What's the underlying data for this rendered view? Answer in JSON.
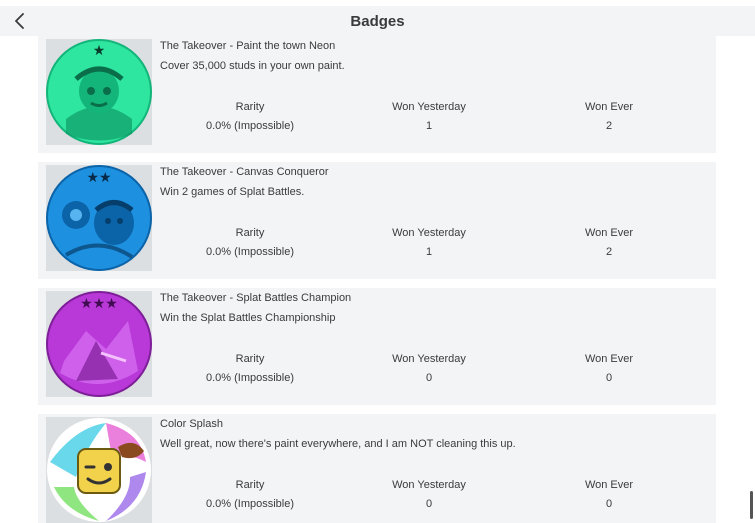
{
  "header": {
    "title": "Badges",
    "back_icon": "chevron-left-icon"
  },
  "stat_labels": {
    "rarity": "Rarity",
    "won_yesterday": "Won Yesterday",
    "won_ever": "Won Ever"
  },
  "badges": [
    {
      "name": "The Takeover - Paint the town Neon",
      "description": "Cover 35,000 studs in your own paint.",
      "rarity": "0.0% (Impossible)",
      "won_yesterday": "1",
      "won_ever": "2",
      "stars": "★",
      "color": "#2ee6a0"
    },
    {
      "name": "The Takeover - Canvas Conqueror",
      "description": "Win 2 games of Splat Battles.",
      "rarity": "0.0% (Impossible)",
      "won_yesterday": "1",
      "won_ever": "2",
      "stars": "★★",
      "color": "#1e90e0"
    },
    {
      "name": "The Takeover - Splat Battles Champion",
      "description": "Win the Splat Battles Championship",
      "rarity": "0.0% (Impossible)",
      "won_yesterday": "0",
      "won_ever": "0",
      "stars": "★★★",
      "color": "#b838d8"
    },
    {
      "name": "Color Splash",
      "description": "Well great, now there's paint everywhere, and I am NOT cleaning this up.",
      "rarity": "0.0% (Impossible)",
      "won_yesterday": "0",
      "won_ever": "0",
      "stars": "",
      "color": "#f2d24a"
    }
  ]
}
